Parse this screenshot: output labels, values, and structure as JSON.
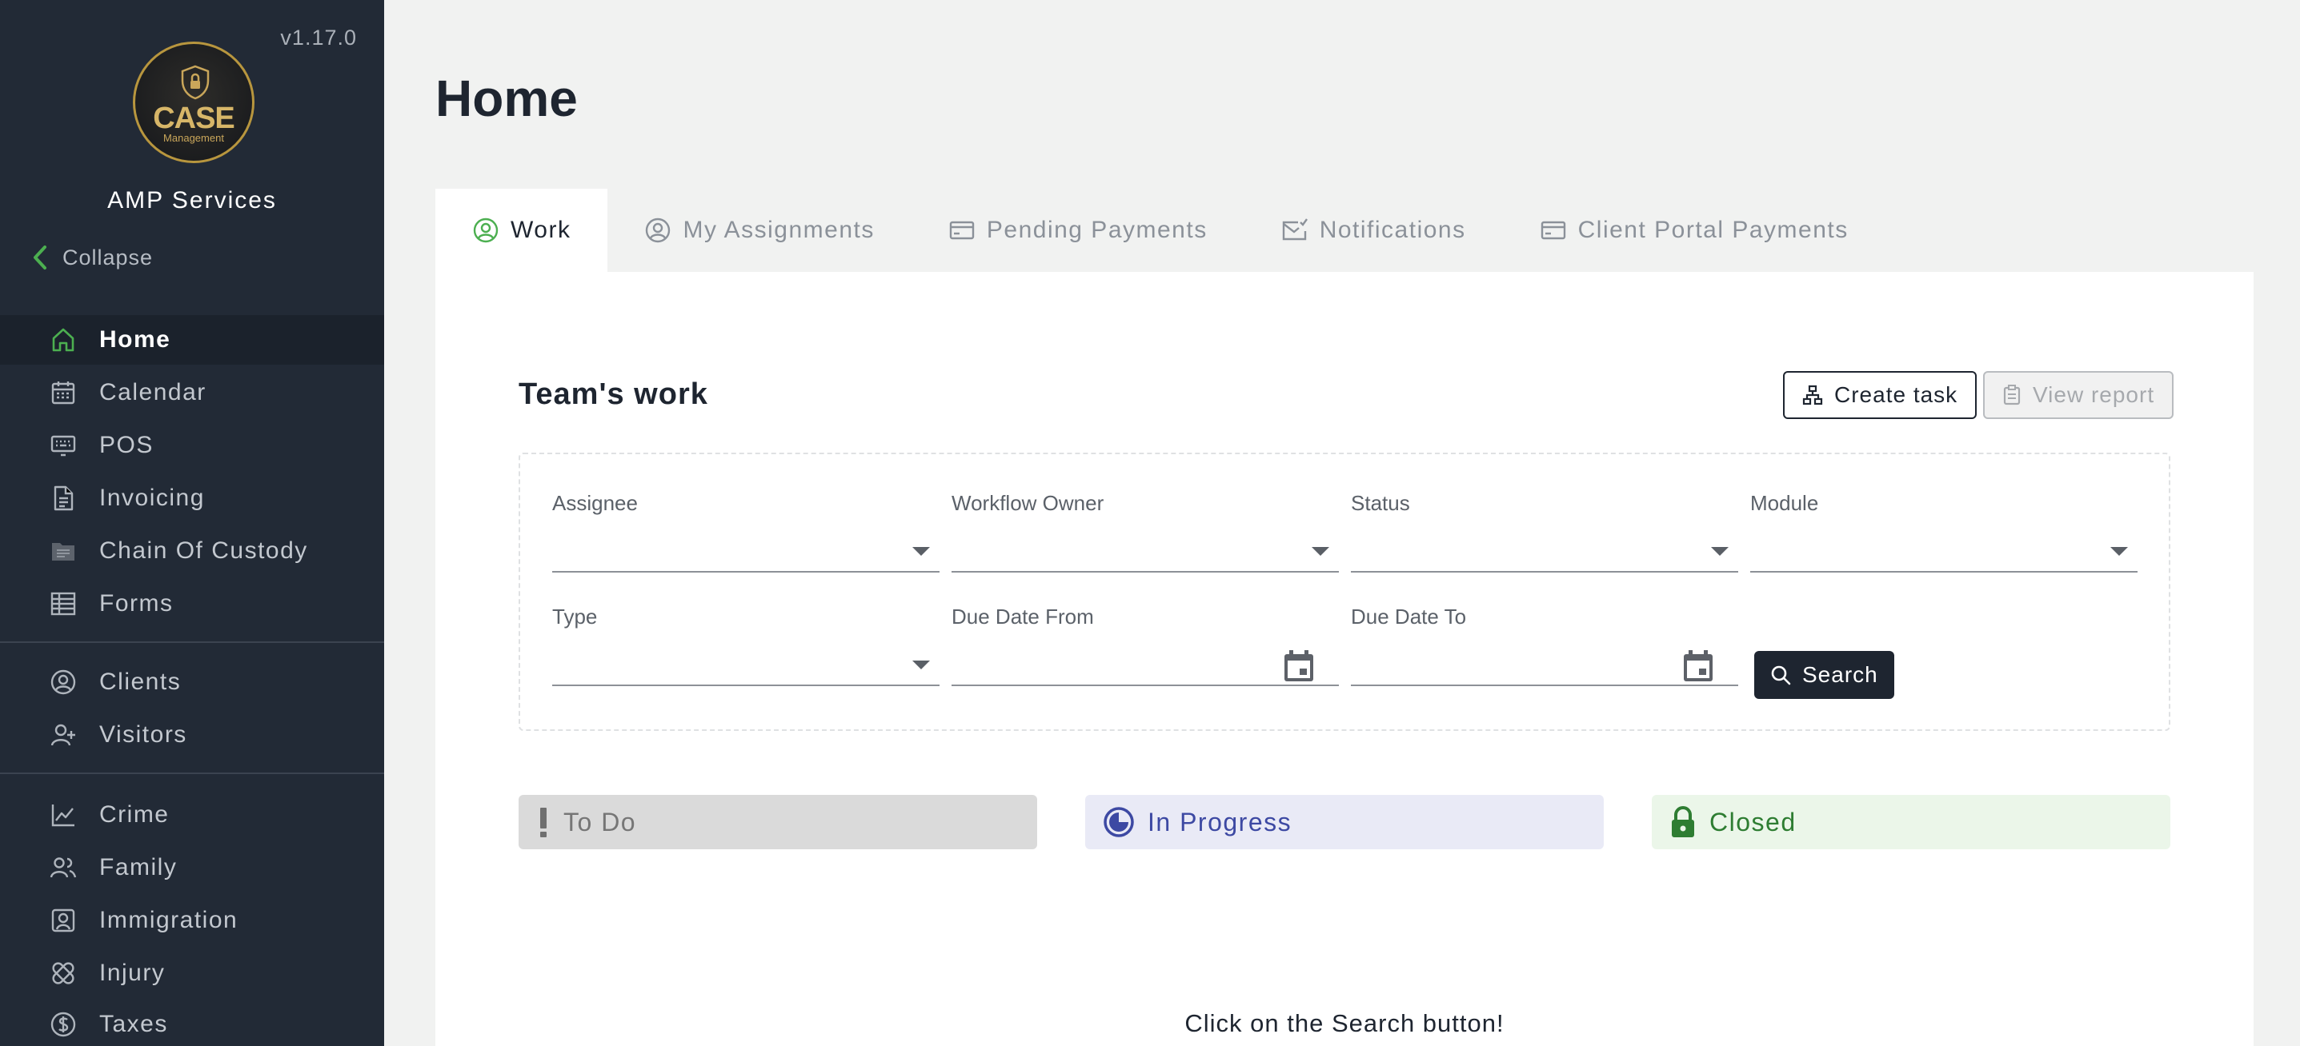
{
  "app": {
    "version": "v1.17.0",
    "logo_text": "CASE",
    "logo_subtext": "Management",
    "org_name": "AMP Services",
    "collapse_label": "Collapse"
  },
  "sidebar": {
    "items": [
      {
        "label": "Home",
        "icon": "home-icon",
        "active": true
      },
      {
        "label": "Calendar",
        "icon": "calendar-icon"
      },
      {
        "label": "POS",
        "icon": "keyboard-icon"
      },
      {
        "label": "Invoicing",
        "icon": "document-icon"
      },
      {
        "label": "Chain Of Custody",
        "icon": "folder-icon"
      },
      {
        "label": "Forms",
        "icon": "form-table-icon"
      },
      {
        "label": "Clients",
        "icon": "user-circle-icon"
      },
      {
        "label": "Visitors",
        "icon": "user-plus-icon"
      },
      {
        "label": "Crime",
        "icon": "chart-line-icon"
      },
      {
        "label": "Family",
        "icon": "users-icon"
      },
      {
        "label": "Immigration",
        "icon": "id-badge-icon"
      },
      {
        "label": "Injury",
        "icon": "bandage-icon"
      },
      {
        "label": "Taxes",
        "icon": "dollar-circle-icon"
      }
    ]
  },
  "page": {
    "title": "Home"
  },
  "tabs": [
    {
      "label": "Work",
      "icon": "user-circle-icon",
      "active": true
    },
    {
      "label": "My Assignments",
      "icon": "user-circle-icon"
    },
    {
      "label": "Pending Payments",
      "icon": "credit-card-icon"
    },
    {
      "label": "Notifications",
      "icon": "mail-check-icon"
    },
    {
      "label": "Client Portal Payments",
      "icon": "credit-card-icon"
    }
  ],
  "work": {
    "section_title": "Team's work",
    "create_task_label": "Create task",
    "view_report_label": "View report",
    "filters": {
      "assignee": {
        "label": "Assignee",
        "value": ""
      },
      "workflow_owner": {
        "label": "Workflow Owner",
        "value": ""
      },
      "status": {
        "label": "Status",
        "value": ""
      },
      "module": {
        "label": "Module",
        "value": ""
      },
      "type": {
        "label": "Type",
        "value": ""
      },
      "due_date_from": {
        "label": "Due Date From",
        "value": ""
      },
      "due_date_to": {
        "label": "Due Date To",
        "value": ""
      }
    },
    "search_label": "Search",
    "statuses": {
      "todo": "To Do",
      "in_progress": "In Progress",
      "closed": "Closed"
    },
    "empty_message": "Click on the Search button!"
  },
  "colors": {
    "sidebar_bg": "#222a36",
    "accent_green": "#4caf50",
    "primary_dark": "#1e2530",
    "todo_bg": "#dadada",
    "in_progress_fg": "#3d49a3",
    "closed_fg": "#2e7d32"
  }
}
